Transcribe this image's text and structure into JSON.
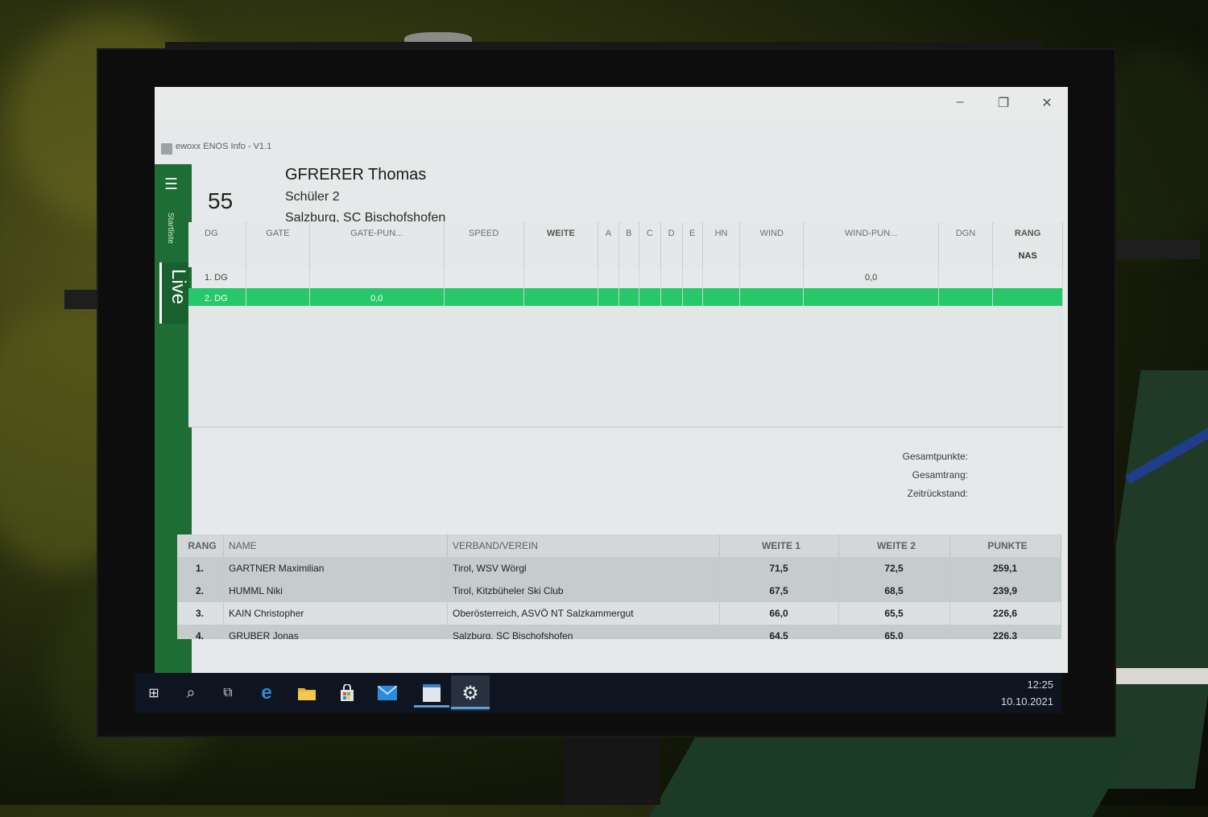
{
  "window": {
    "title": "ewoxx ENOS Info - V1.1",
    "minimize": "–",
    "maximize": "❐",
    "close": "✕"
  },
  "sidebar": {
    "menu_icon": "hamburger-icon",
    "startlist": "Startliste",
    "live": "Live"
  },
  "athlete": {
    "bib": "55",
    "name": "GFRERER Thomas",
    "category": "Schüler 2",
    "club": "Salzburg, SC Bischofshofen"
  },
  "jumps_table": {
    "headers": [
      "DG",
      "GATE",
      "GATE-PUN...",
      "SPEED",
      "WEITE",
      "A",
      "B",
      "C",
      "D",
      "E",
      "HN",
      "WIND",
      "WIND-PUN...",
      "DGN",
      "RANG"
    ],
    "rang_value": "NAS",
    "rows": [
      {
        "dg": "1. DG",
        "gate_pun": "",
        "wind_pun": "0,0"
      },
      {
        "dg": "2. DG",
        "gate_pun": "0,0",
        "wind_pun": ""
      }
    ]
  },
  "totals": {
    "gesamtpunkte": "Gesamtpunkte:",
    "gesamtrang": "Gesamtrang:",
    "zeitrueckstand": "Zeitrückstand:"
  },
  "ranking": {
    "headers": {
      "rang": "RANG",
      "name": "NAME",
      "verein": "VERBAND/VEREIN",
      "weite1": "WEITE 1",
      "weite2": "WEITE 2",
      "punkte": "PUNKTE"
    },
    "rows": [
      {
        "rang": "1.",
        "name": "GARTNER Maximilian",
        "verein": "Tirol, WSV Wörgl",
        "weite1": "71,5",
        "weite2": "72,5",
        "punkte": "259,1"
      },
      {
        "rang": "2.",
        "name": "HUMML Niki",
        "verein": "Tirol, Kitzbüheler Ski Club",
        "weite1": "67,5",
        "weite2": "68,5",
        "punkte": "239,9"
      },
      {
        "rang": "3.",
        "name": "KAIN Christopher",
        "verein": "Oberösterreich, ASVÖ NT Salzkammergut",
        "weite1": "66,0",
        "weite2": "65,5",
        "punkte": "226,6"
      },
      {
        "rang": "4.",
        "name": "GRUBER Jonas",
        "verein": "Salzburg, SC Bischofshofen",
        "weite1": "64,5",
        "weite2": "65,0",
        "punkte": "226,3"
      }
    ]
  },
  "taskbar": {
    "icons": [
      "windows-start-icon",
      "search-icon",
      "task-view-icon",
      "edge-icon",
      "file-explorer-icon",
      "store-icon",
      "mail-icon",
      "app-window-icon",
      "settings-icon"
    ],
    "time": "12:25",
    "date": "10.10.2021"
  },
  "colors": {
    "sidebar_green": "#1d6d34",
    "highlight_green": "#27c86a",
    "taskbar": "#0e1520"
  }
}
